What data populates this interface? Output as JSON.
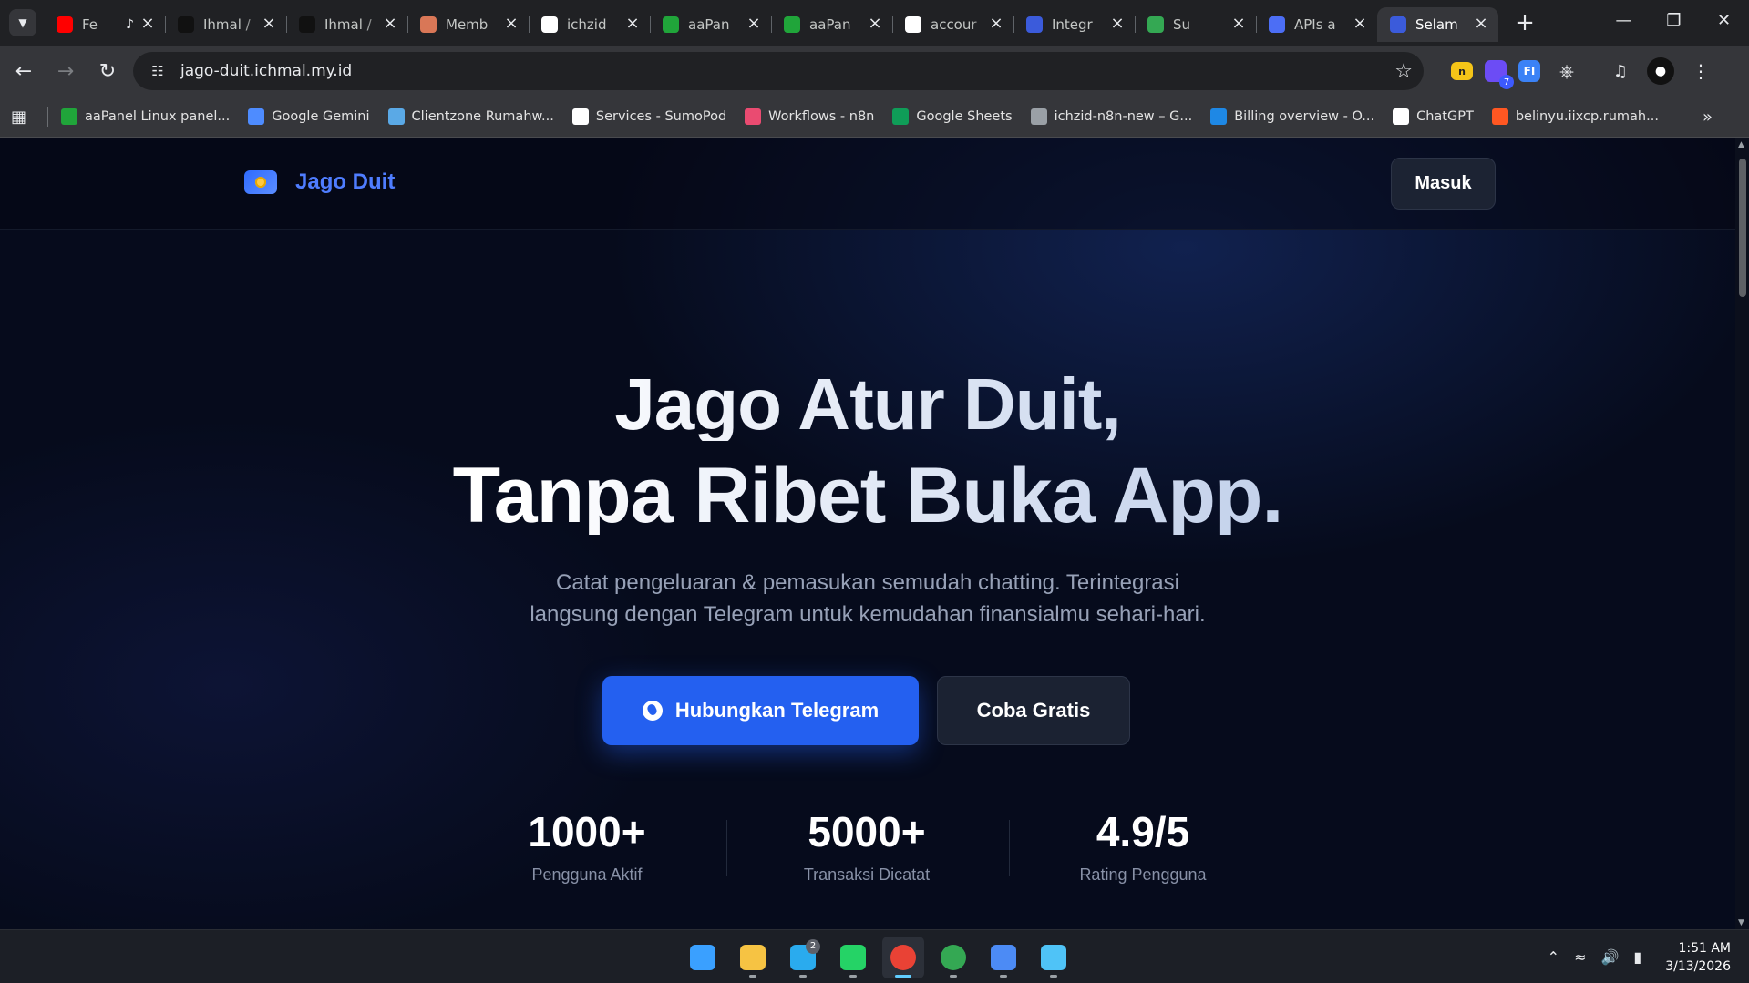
{
  "browser": {
    "tabs": [
      {
        "title": "Fe",
        "icon": "youtube-icon",
        "color": "#ff0000",
        "audio": true
      },
      {
        "title": "Ihmal /",
        "icon": "instapaper-icon",
        "color": "#111111"
      },
      {
        "title": "Ihmal /",
        "icon": "instapaper-icon",
        "color": "#111111"
      },
      {
        "title": "Memb",
        "icon": "claude-icon",
        "color": "#d97757"
      },
      {
        "title": "ichzid",
        "icon": "n8n-cube-icon",
        "color": "#ffffff"
      },
      {
        "title": "aaPan",
        "icon": "aapanel-icon",
        "color": "#20a53a"
      },
      {
        "title": "aaPan",
        "icon": "aapanel-icon",
        "color": "#20a53a"
      },
      {
        "title": "accour",
        "icon": "google-icon",
        "color": "#ffffff"
      },
      {
        "title": "Integr",
        "icon": "card-icon",
        "color": "#3b5bdb"
      },
      {
        "title": "Su",
        "icon": "gift-icon",
        "color": "#34a853"
      },
      {
        "title": "APIs a",
        "icon": "api-icon",
        "color": "#4c6ef5"
      },
      {
        "title": "Selam",
        "icon": "card-icon",
        "color": "#3b5bdb",
        "active": true
      }
    ],
    "address": "jago-duit.ichmal.my.id",
    "extension_badge": "7",
    "bookmarks": [
      {
        "label": "aaPanel Linux panel...",
        "icon": "aapanel-icon",
        "color": "#20a53a"
      },
      {
        "label": "Google Gemini",
        "icon": "gemini-icon",
        "color": "#4e8cff"
      },
      {
        "label": "Clientzone Rumahw...",
        "icon": "house-icon",
        "color": "#5aa9e6"
      },
      {
        "label": "Services - SumoPod",
        "icon": "cube-icon",
        "color": "#ffffff"
      },
      {
        "label": "Workflows - n8n",
        "icon": "n8n-icon",
        "color": "#ea4b71"
      },
      {
        "label": "Google Sheets",
        "icon": "sheets-icon",
        "color": "#0f9d58"
      },
      {
        "label": "ichzid-n8n-new – G...",
        "icon": "github-icon",
        "color": "#9aa0a6"
      },
      {
        "label": "Billing overview - O...",
        "icon": "openai-icon",
        "color": "#1e88e5"
      },
      {
        "label": "ChatGPT",
        "icon": "chatgpt-icon",
        "color": "#ffffff"
      },
      {
        "label": "belinyu.iixcp.rumah...",
        "icon": "link-icon",
        "color": "#ff5722"
      }
    ]
  },
  "site": {
    "brand": "Jago Duit",
    "login": "Masuk",
    "hero_line1": "Jago Atur Duit,",
    "hero_line2": "Tanpa Ribet Buka App.",
    "subtitle_line1": "Catat pengeluaran & pemasukan semudah chatting. Terintegrasi",
    "subtitle_line2": "langsung dengan Telegram untuk kemudahan finansialmu sehari-hari.",
    "cta_primary": "Hubungkan Telegram",
    "cta_secondary": "Coba Gratis",
    "stats": [
      {
        "value": "1000+",
        "label": "Pengguna Aktif"
      },
      {
        "value": "5000+",
        "label": "Transaksi Dicatat"
      },
      {
        "value": "4.9/5",
        "label": "Rating Pengguna"
      }
    ],
    "colors": {
      "accent": "#2460f0",
      "brand": "#4f7dff",
      "background": "#060b1c"
    }
  },
  "taskbar": {
    "apps": [
      {
        "name": "windows-start-icon",
        "color": "#3aa0ff"
      },
      {
        "name": "file-explorer-icon",
        "color": "#f6c343"
      },
      {
        "name": "telegram-icon",
        "color": "#2aabee",
        "badge": "2"
      },
      {
        "name": "whatsapp-icon",
        "color": "#25d366"
      },
      {
        "name": "chrome-icon",
        "color": "#e94235",
        "active": true
      },
      {
        "name": "chrome-icon",
        "color": "#34a853"
      },
      {
        "name": "app-a-icon",
        "color": "#4c8bf5"
      },
      {
        "name": "notepad-icon",
        "color": "#4fc3f7"
      }
    ],
    "time": "1:51 AM",
    "date": "3/13/2026"
  }
}
